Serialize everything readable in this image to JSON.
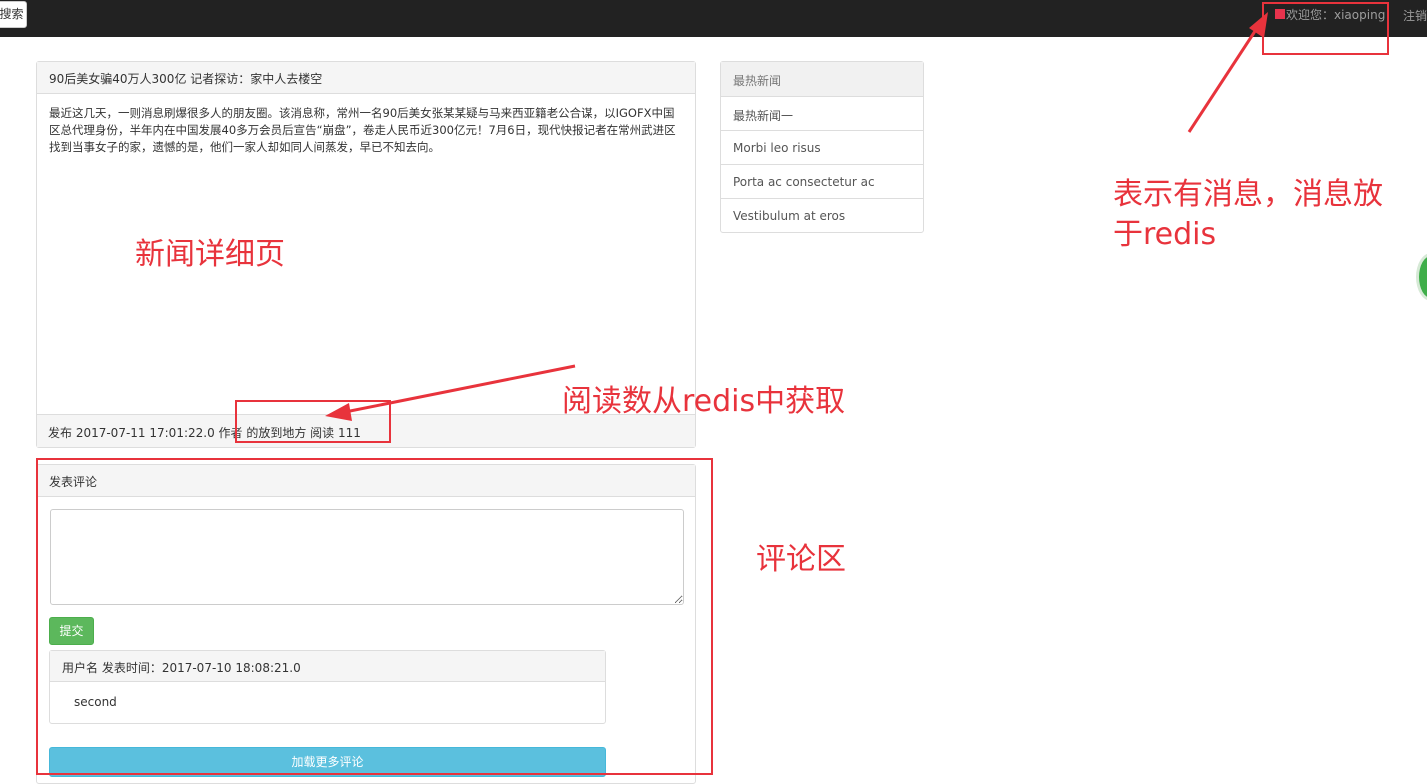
{
  "navbar": {
    "search_label": "搜索",
    "welcome_text": "欢迎您：xiaoping",
    "logout_label": "注销",
    "message_indicator_color": "#e8334d"
  },
  "article": {
    "title": "90后美女骗40万人300亿 记者探访：家中人去楼空",
    "body": "最近这几天，一则消息刷爆很多人的朋友圈。该消息称，常州一名90后美女张某某疑与马来西亚籍老公合谋，以IGOFX中国区总代理身份，半年内在中国发展40多万会员后宣告“崩盘”，卷走人民币近300亿元！7月6日，现代快报记者在常州武进区找到当事女子的家，遗憾的是，他们一家人却如同人间蒸发，早已不知去向。",
    "footer": "发布 2017-07-11 17:01:22.0 作者 的放到地方 阅读 111"
  },
  "hot_news": {
    "heading": "最热新闻",
    "items": [
      "最热新闻一",
      "Morbi leo risus",
      "Porta ac consectetur ac",
      "Vestibulum at eros"
    ]
  },
  "comments": {
    "heading": "发表评论",
    "textarea_value": "",
    "submit_label": "提交",
    "items": [
      {
        "header": "用户名 发表时间：2017-07-10 18:08:21.0",
        "content": "second"
      }
    ],
    "load_more_label": "加载更多评论"
  },
  "annotations": {
    "news_detail": "新闻详细页",
    "read_count": "阅读数从redis中获取",
    "comment_area": "评论区",
    "message_note_line1": "表示有消息，消息放",
    "message_note_line2": "于redis",
    "color": "#e8333c"
  }
}
